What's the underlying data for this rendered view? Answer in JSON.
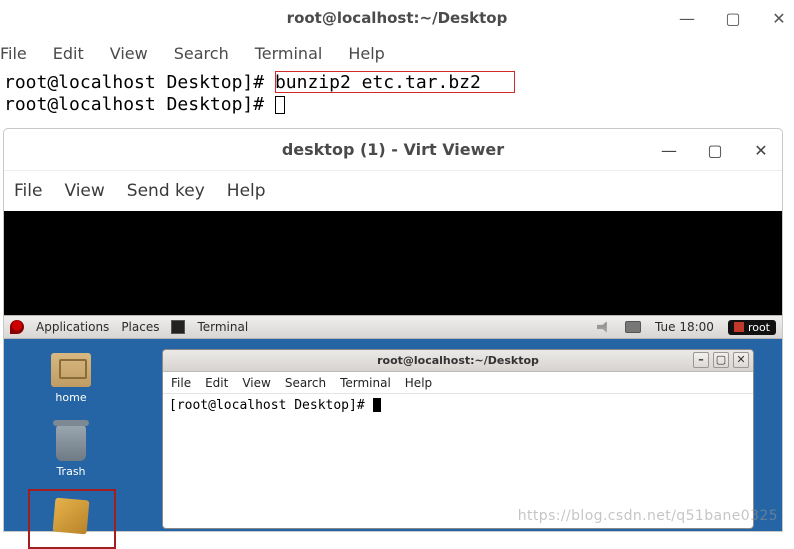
{
  "outer": {
    "title": "root@localhost:~/Desktop",
    "controls": {
      "min": "—",
      "max": "▢",
      "close": "✕"
    },
    "menu": [
      "File",
      "Edit",
      "View",
      "Search",
      "Terminal",
      "Help"
    ],
    "prompt": "root@localhost Desktop]#",
    "command": "bunzip2 etc.tar.bz2"
  },
  "viewer": {
    "title": "desktop (1) - Virt Viewer",
    "controls": {
      "min": "—",
      "max": "▢",
      "close": "✕"
    },
    "menu": [
      "File",
      "View",
      "Send key",
      "Help"
    ]
  },
  "guest": {
    "panel": {
      "apps": "Applications",
      "places": "Places",
      "terminal": "Terminal",
      "time": "Tue 18:00",
      "user": "root"
    },
    "icons": {
      "home": "home",
      "trash": "Trash"
    },
    "inner_terminal": {
      "title": "root@localhost:~/Desktop",
      "menu": [
        "File",
        "Edit",
        "View",
        "Search",
        "Terminal",
        "Help"
      ],
      "prompt": "[root@localhost Desktop]#"
    }
  },
  "watermark": "https://blog.csdn.net/q51bane0325"
}
